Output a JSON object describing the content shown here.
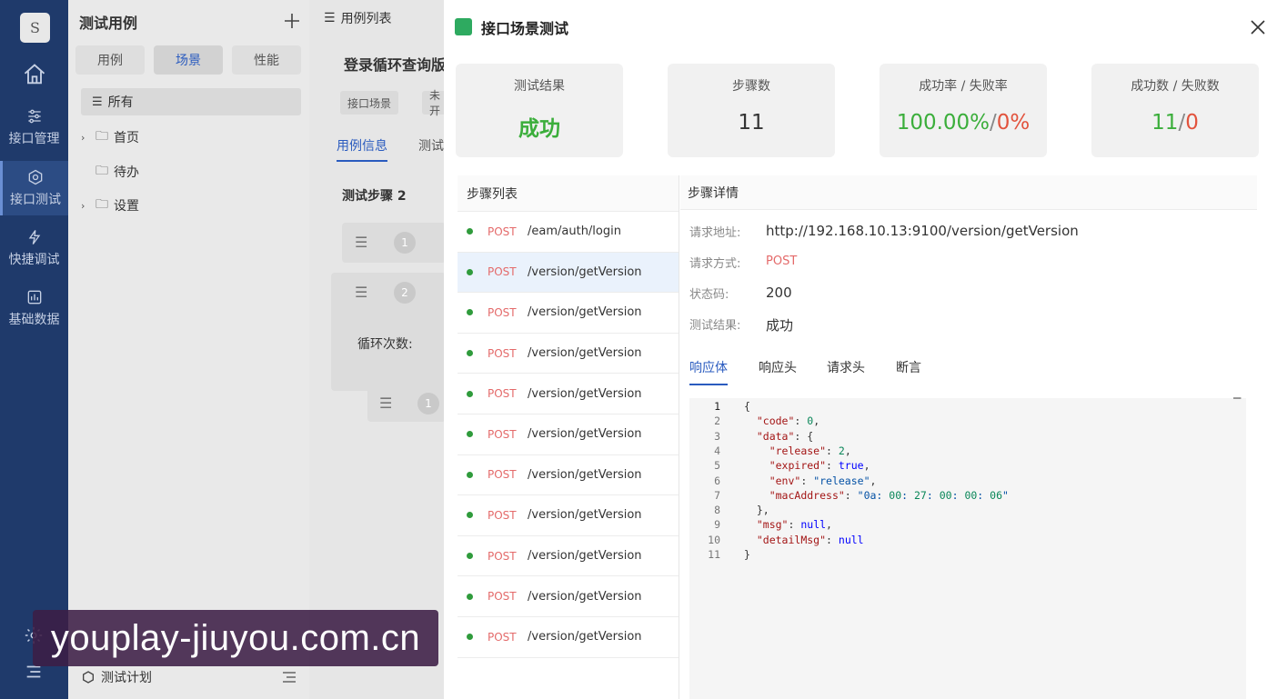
{
  "nav": {
    "avatar": "S",
    "items": [
      {
        "label": "接口管理",
        "icon": "sliders-icon"
      },
      {
        "label": "接口测试",
        "icon": "hexagon-icon"
      },
      {
        "label": "快捷调试",
        "icon": "lightning-icon"
      },
      {
        "label": "基础数据",
        "icon": "chart-icon"
      }
    ]
  },
  "tree": {
    "title": "测试用例",
    "segments": [
      "用例",
      "场景",
      "性能"
    ],
    "all_label": "所有",
    "nodes": [
      "首页",
      "待办",
      "设置"
    ],
    "footer_label": "测试计划"
  },
  "mid": {
    "breadcrumb": "用例列表",
    "case_name": "登录循环查询版",
    "tags": [
      "接口场景",
      "未开"
    ],
    "tabs": [
      "用例信息",
      "测试"
    ],
    "step_label": "测试步骤 2",
    "step_numbers": [
      "1",
      "2",
      "1"
    ],
    "loop_label": "循环次数:"
  },
  "drawer": {
    "title": "接口场景测试",
    "stats": {
      "result": {
        "label": "测试结果",
        "value": "成功"
      },
      "steps": {
        "label": "步骤数",
        "value": "11"
      },
      "rate": {
        "label": "成功率 / 失败率",
        "success": "100.00%",
        "sep": "/",
        "fail": "0%"
      },
      "count": {
        "label": "成功数 / 失败数",
        "success": "11",
        "sep": "/",
        "fail": "0"
      }
    },
    "step_list_title": "步骤列表",
    "steps": [
      {
        "method": "POST",
        "path": "/eam/auth/login"
      },
      {
        "method": "POST",
        "path": "/version/getVersion"
      },
      {
        "method": "POST",
        "path": "/version/getVersion"
      },
      {
        "method": "POST",
        "path": "/version/getVersion"
      },
      {
        "method": "POST",
        "path": "/version/getVersion"
      },
      {
        "method": "POST",
        "path": "/version/getVersion"
      },
      {
        "method": "POST",
        "path": "/version/getVersion"
      },
      {
        "method": "POST",
        "path": "/version/getVersion"
      },
      {
        "method": "POST",
        "path": "/version/getVersion"
      },
      {
        "method": "POST",
        "path": "/version/getVersion"
      },
      {
        "method": "POST",
        "path": "/version/getVersion"
      }
    ],
    "selected_step": 1,
    "detail": {
      "title": "步骤详情",
      "url_label": "请求地址:",
      "url": "http://192.168.10.13:9100/version/getVersion",
      "method_label": "请求方式:",
      "method": "POST",
      "status_label": "状态码:",
      "status": "200",
      "result_label": "测试结果:",
      "result": "成功",
      "tabs": [
        "响应体",
        "响应头",
        "请求头",
        "断言"
      ]
    },
    "code_lines": [
      "{",
      "  \"code\": 0,",
      "  \"data\": {",
      "    \"release\": 2,",
      "    \"expired\": true,",
      "    \"env\": \"release\",",
      "    \"macAddress\": \"0a:00:27:00:00:06\"",
      "  },",
      "  \"msg\": null,",
      "  \"detailMsg\": null",
      "}"
    ]
  },
  "watermark": "youplay-jiuyou.com.cn",
  "colors": {
    "nav": "#1f3a6b",
    "success": "#3bae3b",
    "fail": "#e2533d",
    "accent": "#2a5bbf",
    "post": "#e46a6a"
  }
}
